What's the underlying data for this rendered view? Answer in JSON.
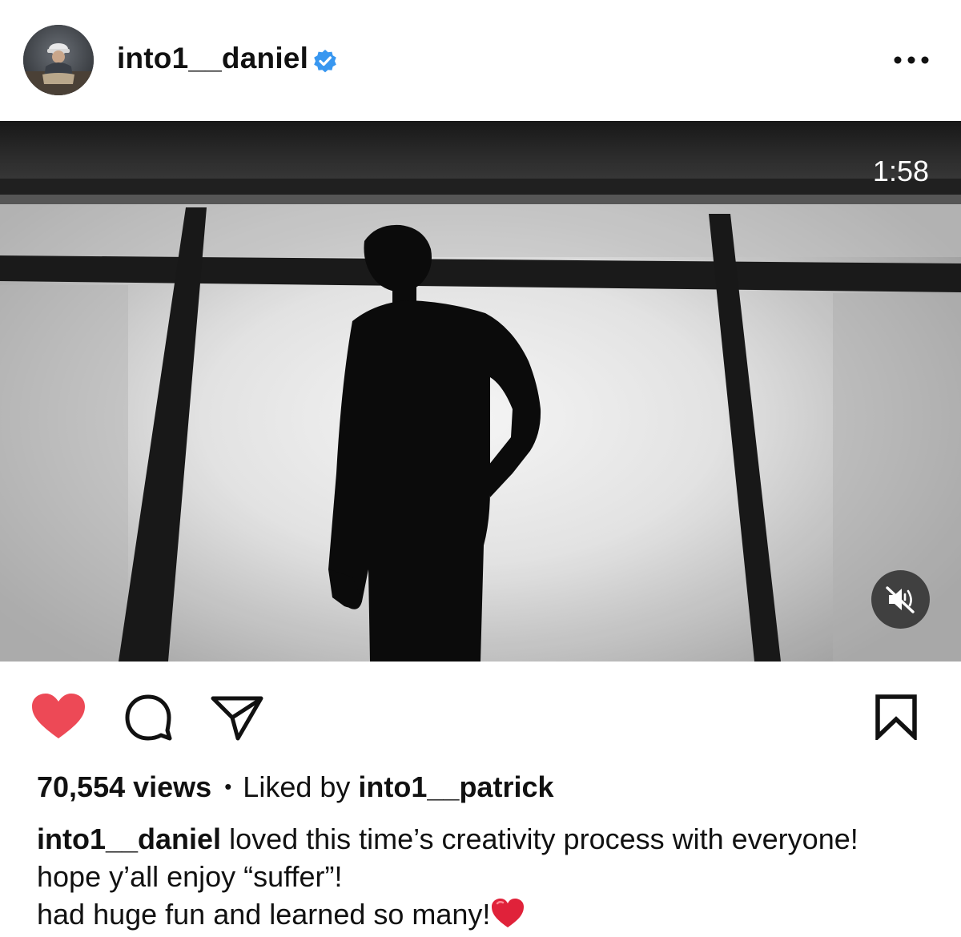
{
  "header": {
    "username": "into1__daniel",
    "verified": true,
    "avatar_icon": "avatar-photo",
    "more_icon": "more-horizontal-icon"
  },
  "video": {
    "duration": "1:58",
    "muted": true,
    "mute_icon": "speaker-muted-icon"
  },
  "actions": {
    "liked": true,
    "like_icon": "heart-filled-icon",
    "comment_icon": "comment-icon",
    "share_icon": "send-icon",
    "save_icon": "bookmark-icon",
    "like_color": "#ed4956"
  },
  "stats": {
    "views": "70,554 views",
    "separator": "•",
    "liked_by_prefix": "Liked by",
    "liked_by_user": "into1__patrick"
  },
  "caption": {
    "user": "into1__daniel",
    "line1": "loved this time’s creativity process with everyone!",
    "line2": "hope y’all enjoy “suffer”!",
    "line3": "had huge fun and learned so many!",
    "emoji": "❤️"
  },
  "colors": {
    "verified_blue": "#3897f0",
    "text": "#111111",
    "background": "#ffffff"
  }
}
